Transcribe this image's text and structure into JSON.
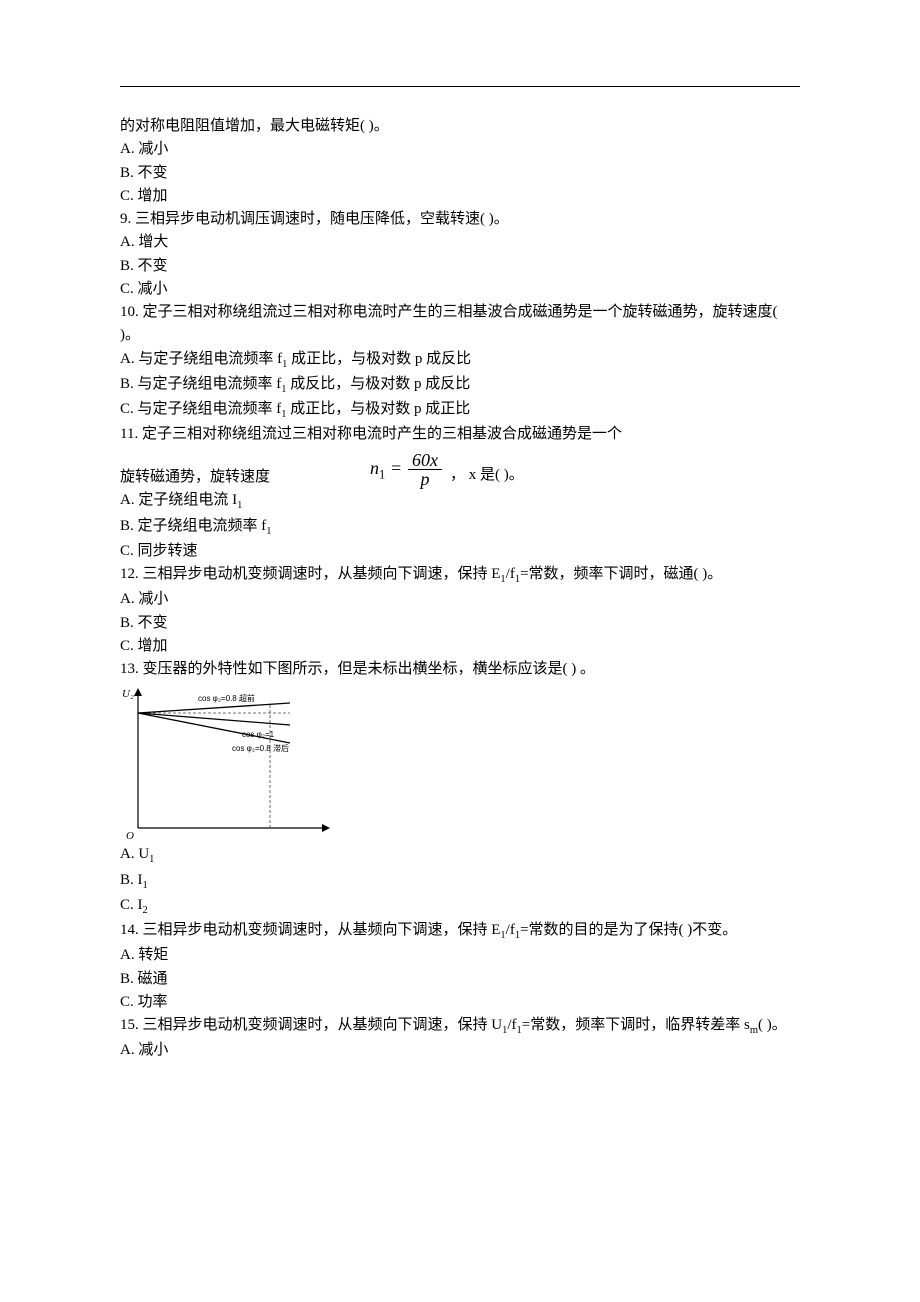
{
  "chart_data": {
    "type": "line",
    "title": "",
    "xlabel": "",
    "ylabel": "U₂",
    "xlim": [
      0,
      1
    ],
    "ylim": [
      0,
      1.2
    ],
    "series": [
      {
        "name": "cos φ₂=0.8 超前",
        "x": [
          0,
          1
        ],
        "y": [
          1.0,
          1.08
        ]
      },
      {
        "name": "cos φ₂=1",
        "x": [
          0,
          1
        ],
        "y": [
          1.0,
          0.93
        ]
      },
      {
        "name": "cos φ₂=0.8 滞后",
        "x": [
          0,
          1
        ],
        "y": [
          1.0,
          0.8
        ]
      }
    ],
    "annotations": [
      "cos φ₂=0.8 超前",
      "cos φ₂=1",
      "cos φ₂=0.8 滞后"
    ]
  },
  "q8": {
    "cont": "的对称电阻阻值增加，最大电磁转矩( )。",
    "a": "A.  减小",
    "b": "B.  不变",
    "c": "C.  增加"
  },
  "q9": {
    "stem": "9.  三相异步电动机调压调速时，随电压降低，空载转速( )。",
    "a": "A.  增大",
    "b": "B.  不变",
    "c": "C.  减小"
  },
  "q10": {
    "stem": "10.  定子三相对称绕组流过三相对称电流时产生的三相基波合成磁通势是一个旋转磁通势，旋转速度( )。",
    "a_pre": "A.  与定子绕组电流频率 f",
    "a_sub": "1",
    "a_post": " 成正比，与极对数 p 成反比",
    "b_pre": "B.  与定子绕组电流频率 f",
    "b_sub": "1",
    "b_post": " 成反比，与极对数 p 成反比",
    "c_pre": "C.  与定子绕组电流频率 f",
    "c_sub": "1",
    "c_post": " 成正比，与极对数 p 成正比"
  },
  "q11": {
    "stem": "11.  定子三相对称绕组流过三相对称电流时产生的三相基波合成磁通势是一个",
    "lead": "旋转磁通势，旋转速度",
    "formula_lhs": "n",
    "formula_lhs_sub": "1",
    "formula_eq": " = ",
    "formula_num": "60x",
    "formula_den": "p",
    "tail": "，  x 是( )。",
    "a_pre": "A.  定子绕组电流 I",
    "a_sub": "1",
    "b_pre": "B.  定子绕组电流频率 f",
    "b_sub": "1",
    "c": "C.  同步转速"
  },
  "q12": {
    "stem_pre": "12.  三相异步电动机变频调速时，从基频向下调速，保持 E",
    "stem_sub1": "1",
    "stem_mid": "/f",
    "stem_sub2": "1",
    "stem_post": "=常数，频率下调时，磁通( )。",
    "a": "A.  减小",
    "b": "B.  不变",
    "c": "C.  增加"
  },
  "q13": {
    "stem": "13.  变压器的外特性如下图所示，但是未标出横坐标，横坐标应该是( ) 。",
    "y_axis": "U₂",
    "series1": "cos φ₂=0.8 超前",
    "series2": "cos φ₂=1",
    "series3": "cos φ₂=0.8 滞后",
    "origin": "O",
    "a_pre": "A.  U",
    "a_sub": "1",
    "b_pre": "B.  I",
    "b_sub": "1",
    "c_pre": "C.  I",
    "c_sub": "2"
  },
  "q14": {
    "stem_pre": "14.  三相异步电动机变频调速时，从基频向下调速，保持 E",
    "stem_sub1": "1",
    "stem_mid": "/f",
    "stem_sub2": "1",
    "stem_post": "=常数的目的是为了保持( )不变。",
    "a": "A.  转矩",
    "b": "B.  磁通",
    "c": "C.  功率"
  },
  "q15": {
    "stem_pre": "15.  三相异步电动机变频调速时，从基频向下调速，保持 U",
    "stem_sub1": "1",
    "stem_mid": "/f",
    "stem_sub2": "1",
    "stem_post": "=常数，频率下调时，临界转差率 s",
    "stem_sub3": "m",
    "stem_end": "( )。",
    "a": "A.  减小"
  }
}
